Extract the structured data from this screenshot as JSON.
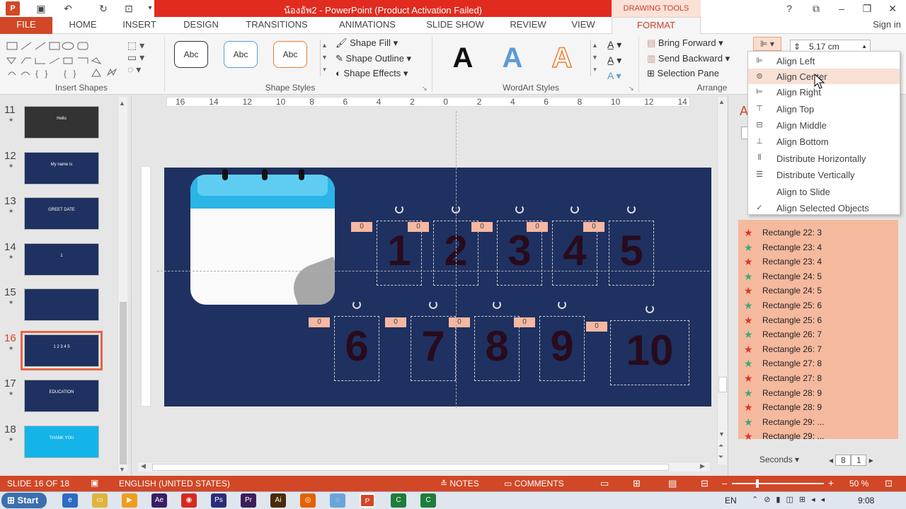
{
  "titlebar": {
    "title": "น้องอัพ2 - PowerPoint (Product Activation Failed)",
    "drawing_tools": "DRAWING TOOLS",
    "help": "?",
    "signin": "Sign in"
  },
  "tabs": [
    "FILE",
    "HOME",
    "INSERT",
    "DESIGN",
    "TRANSITIONS",
    "ANIMATIONS",
    "SLIDE SHOW",
    "REVIEW",
    "VIEW",
    "FORMAT"
  ],
  "ribbon": {
    "groups": {
      "insert_shapes": "Insert Shapes",
      "shape_styles": "Shape Styles",
      "wordart_styles": "WordArt Styles",
      "arrange": "Arrange"
    },
    "shape_style_sample": "Abc",
    "shape_fill": "Shape Fill",
    "shape_outline": "Shape Outline",
    "shape_effects": "Shape Effects",
    "wordart_letter": "A",
    "bring_forward": "Bring Forward",
    "send_backward": "Send Backward",
    "selection_pane": "Selection Pane",
    "size_value": "5.17 cm"
  },
  "slides": [
    {
      "num": "11",
      "label": "Hello",
      "color": "#333333"
    },
    {
      "num": "12",
      "label": "My name is",
      "color": "#1f3160"
    },
    {
      "num": "13",
      "label": "GREET DATE",
      "color": "#1f3160"
    },
    {
      "num": "14",
      "label": "1",
      "color": "#1f3160"
    },
    {
      "num": "15",
      "label": "",
      "color": "#1f3160"
    },
    {
      "num": "16",
      "label": "1 2 3 4 5",
      "color": "#1f3160"
    },
    {
      "num": "17",
      "label": "EDUCATION",
      "color": "#1f3160"
    },
    {
      "num": "18",
      "label": "THANK YOU",
      "color": "#14b4e8"
    }
  ],
  "ruler_h": [
    "16",
    "14",
    "12",
    "10",
    "8",
    "6",
    "4",
    "2",
    "0",
    "2",
    "4",
    "6",
    "8",
    "10",
    "12",
    "14"
  ],
  "slide_numbers": [
    "1",
    "2",
    "3",
    "4",
    "5",
    "6",
    "7",
    "8",
    "9",
    "10"
  ],
  "tag_value": "0",
  "align_menu": [
    {
      "label": "Align Left",
      "icon": "align-left-icon"
    },
    {
      "label": "Align Center",
      "icon": "align-center-icon"
    },
    {
      "label": "Align Right",
      "icon": "align-right-icon"
    },
    {
      "label": "Align Top",
      "icon": "align-top-icon"
    },
    {
      "label": "Align Middle",
      "icon": "align-middle-icon"
    },
    {
      "label": "Align Bottom",
      "icon": "align-bottom-icon"
    },
    {
      "label": "Distribute Horizontally",
      "icon": "distribute-horizontal-icon"
    },
    {
      "label": "Distribute Vertically",
      "icon": "distribute-vertical-icon"
    },
    {
      "label": "Align to Slide",
      "icon": ""
    },
    {
      "label": "Align Selected Objects",
      "icon": "check-icon"
    }
  ],
  "anim_pane": {
    "letter": "A",
    "items": [
      {
        "label": "Rectangle 22: 3",
        "type": "exit"
      },
      {
        "label": "Rectangle 23: 4",
        "type": "entrance"
      },
      {
        "label": "Rectangle 23: 4",
        "type": "exit"
      },
      {
        "label": "Rectangle 24: 5",
        "type": "entrance"
      },
      {
        "label": "Rectangle 24: 5",
        "type": "exit"
      },
      {
        "label": "Rectangle 25: 6",
        "type": "entrance"
      },
      {
        "label": "Rectangle 25: 6",
        "type": "exit"
      },
      {
        "label": "Rectangle 26: 7",
        "type": "entrance"
      },
      {
        "label": "Rectangle 26: 7",
        "type": "exit"
      },
      {
        "label": "Rectangle 27: 8",
        "type": "entrance"
      },
      {
        "label": "Rectangle 27: 8",
        "type": "exit"
      },
      {
        "label": "Rectangle 28: 9",
        "type": "entrance"
      },
      {
        "label": "Rectangle 28: 9",
        "type": "exit"
      },
      {
        "label": "Rectangle 29: ...",
        "type": "entrance"
      },
      {
        "label": "Rectangle 29: ...",
        "type": "exit"
      }
    ],
    "seconds_label": "Seconds",
    "zoom_left": "8",
    "zoom_right": "1"
  },
  "colors": {
    "entrance": "#3aa879",
    "exit": "#d8372a",
    "accent": "#d24726"
  },
  "status": {
    "slide_info": "SLIDE 16 OF 18",
    "language": "ENGLISH (UNITED STATES)",
    "notes": "NOTES",
    "comments": "COMMENTS",
    "zoom": "50 %"
  },
  "taskbar": {
    "start": "Start",
    "lang": "EN",
    "time": "9:08"
  }
}
